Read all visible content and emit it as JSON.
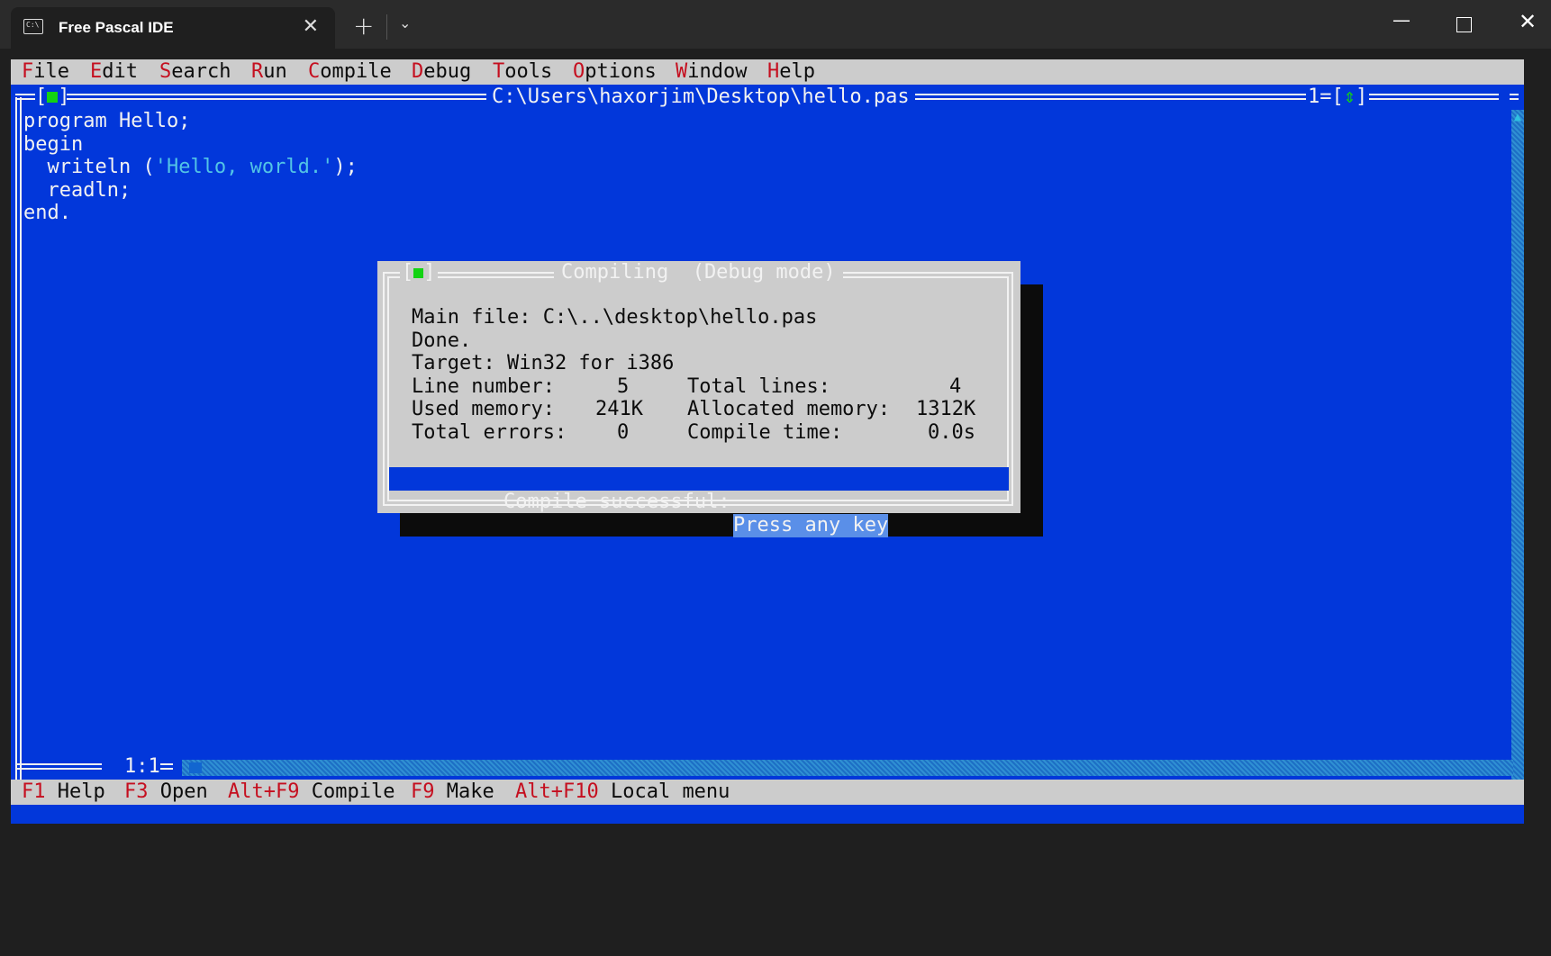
{
  "window": {
    "tab_title": "Free Pascal IDE",
    "tab_icon": "terminal-icon",
    "tab_icon_text": "C:\\",
    "new_tab_glyph": "+",
    "dropdown_glyph": "⌄",
    "minimize_glyph": "—",
    "close_glyph": "✕"
  },
  "menu": [
    {
      "hot": "F",
      "rest": "ile"
    },
    {
      "hot": "E",
      "rest": "dit"
    },
    {
      "hot": "S",
      "rest": "earch"
    },
    {
      "hot": "R",
      "rest": "un"
    },
    {
      "hot": "C",
      "rest": "ompile"
    },
    {
      "hot": "D",
      "rest": "ebug"
    },
    {
      "hot": "T",
      "rest": "ools"
    },
    {
      "hot": "O",
      "rest": "ptions"
    },
    {
      "hot": "W",
      "rest": "indow"
    },
    {
      "hot": "H",
      "rest": "elp"
    }
  ],
  "editor": {
    "file_path": "C:\\Users\\haxorjim\\Desktop\\hello.pas",
    "window_number": "1",
    "cursor_position": "1:1",
    "code": {
      "line1": "program Hello;",
      "line2": "begin",
      "line3_pre": "  writeln (",
      "line3_str": "'Hello, world.'",
      "line3_post": ");",
      "line4": "  readln;",
      "line5": "end."
    }
  },
  "dialog": {
    "title": "Compiling  (Debug mode)",
    "main_file": "Main file: C:\\..\\desktop\\hello.pas",
    "done": "Done.",
    "target": "Target: Win32 for i386",
    "stats": {
      "line_number_label": "Line number:",
      "line_number": "5",
      "total_lines_label": "Total lines:",
      "total_lines": "4",
      "used_memory_label": "Used memory:",
      "used_memory": "241K",
      "allocated_memory_label": "Allocated memory:",
      "allocated_memory": "1312K",
      "total_errors_label": "Total errors:",
      "total_errors": "0",
      "compile_time_label": "Compile time:",
      "compile_time": "0.0s"
    },
    "status_message": "Compile successful:",
    "press_key": "Press any key"
  },
  "statusbar": [
    {
      "key": "F1",
      "label": "Help"
    },
    {
      "key": "F3",
      "label": "Open"
    },
    {
      "key": "Alt+F9",
      "label": "Compile"
    },
    {
      "key": "F9",
      "label": "Make"
    },
    {
      "key": "Alt+F10",
      "label": "Local menu"
    }
  ],
  "colors": {
    "editor_bg": "#0237da",
    "menu_bg": "#cccccc",
    "hotkey": "#c50f1f",
    "string": "#52c4e6",
    "indicator_green": "#13d313"
  }
}
